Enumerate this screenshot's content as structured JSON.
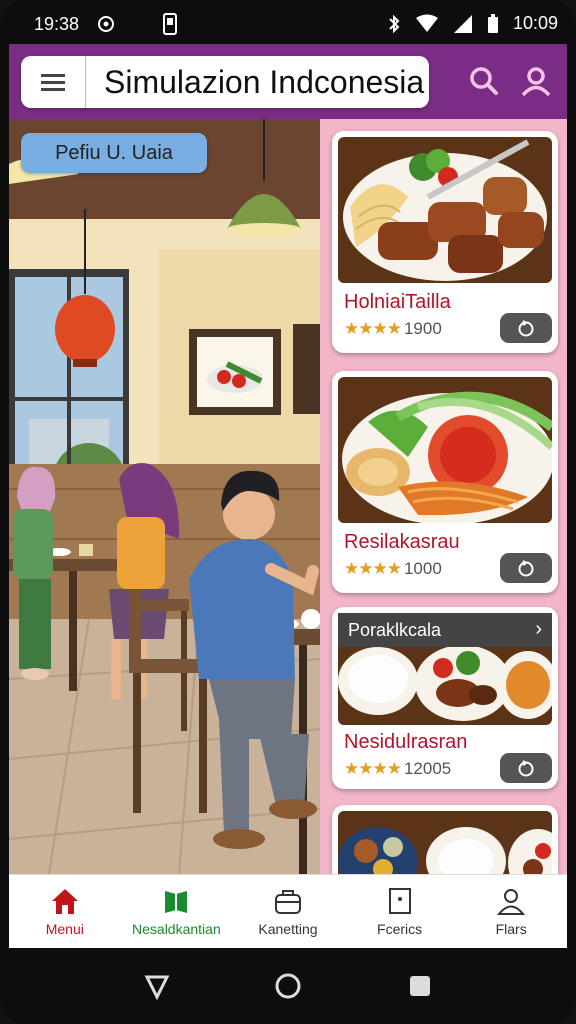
{
  "status_bar": {
    "time_left": "19:38",
    "time_right": "10:09"
  },
  "app_bar": {
    "title": "Simulazion Indconesia"
  },
  "illustration": {
    "label": "Pefiu U. Uaia"
  },
  "cards": [
    {
      "name": "HolniaiTailla",
      "rating": "1900",
      "stars": "★★★★"
    },
    {
      "name": "Resilakasrau",
      "rating": "1000",
      "stars": "★★★★"
    },
    {
      "banner": "Poraklkcala",
      "name": "Nesidulrasran",
      "rating": "12005",
      "stars": "★★★★"
    }
  ],
  "bottom_nav": [
    {
      "label": "Menui",
      "icon": "home-icon"
    },
    {
      "label": "Nesaldkantian",
      "icon": "book-icon"
    },
    {
      "label": "Kanetting",
      "icon": "briefcase-icon"
    },
    {
      "label": "Fcerics",
      "icon": "document-icon"
    },
    {
      "label": "Flars",
      "icon": "user-icon"
    }
  ],
  "colors": {
    "brand": "#7b2d86",
    "list_bg": "#f3b6c8",
    "accent_red": "#c0141a",
    "accent_green": "#1c8a2e",
    "label_blue": "#79aee3"
  }
}
